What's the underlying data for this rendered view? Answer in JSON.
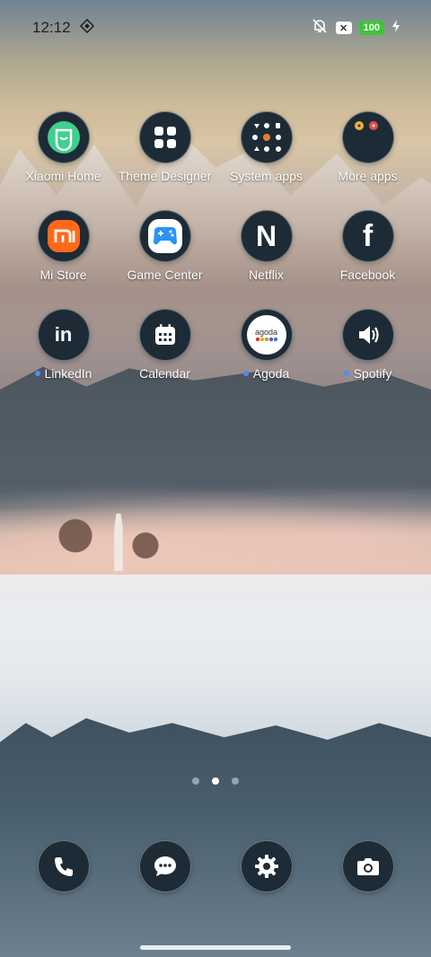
{
  "status_bar": {
    "time": "12:12",
    "battery": "100",
    "x_badge": "✕"
  },
  "apps": [
    {
      "label": "Xiaomi Home",
      "icon": "xiaomi-home-icon",
      "dot": false
    },
    {
      "label": "Theme Designer",
      "icon": "theme-designer-icon",
      "dot": false
    },
    {
      "label": "System apps",
      "icon": "folder-system-apps-icon",
      "dot": false
    },
    {
      "label": "More apps",
      "icon": "folder-more-apps-icon",
      "dot": false
    },
    {
      "label": "Mi Store",
      "icon": "mi-store-icon",
      "dot": false
    },
    {
      "label": "Game Center",
      "icon": "game-center-icon",
      "dot": false
    },
    {
      "label": "Netflix",
      "icon": "netflix-icon",
      "dot": false
    },
    {
      "label": "Facebook",
      "icon": "facebook-icon",
      "dot": false
    },
    {
      "label": "LinkedIn",
      "icon": "linkedin-icon",
      "dot": true
    },
    {
      "label": "Calendar",
      "icon": "calendar-icon",
      "dot": false
    },
    {
      "label": "Agoda",
      "icon": "agoda-icon",
      "dot": true
    },
    {
      "label": "Spotify",
      "icon": "spotify-icon",
      "dot": true
    }
  ],
  "glyphs": {
    "netflix": "N",
    "facebook": "f",
    "linkedin": "in",
    "agoda": "agoda",
    "mi": "mi"
  },
  "dock": [
    {
      "icon": "phone-icon"
    },
    {
      "icon": "messages-icon"
    },
    {
      "icon": "settings-icon"
    },
    {
      "icon": "camera-icon"
    }
  ],
  "page_indicator": {
    "pages": 3,
    "active": 2
  },
  "colors": {
    "icon_bg": "#1d2b36",
    "notification_dot": "#4a8cff",
    "battery": "#3ec43a"
  }
}
